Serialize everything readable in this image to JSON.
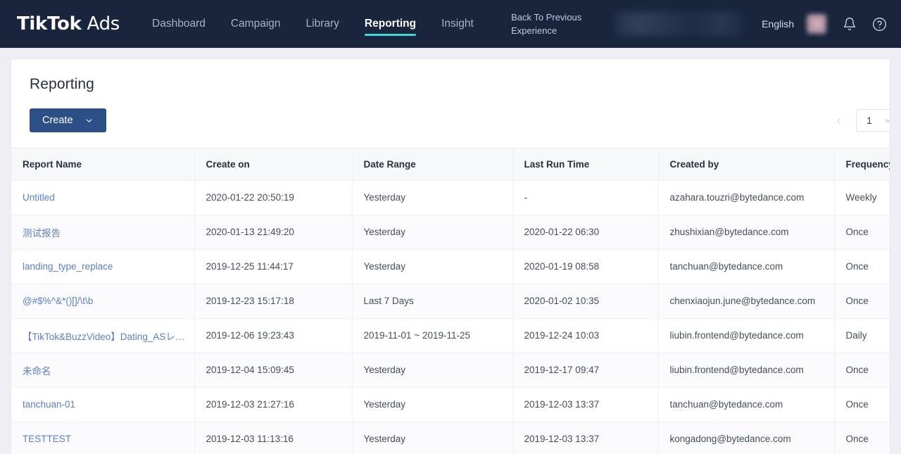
{
  "topnav": {
    "brand_bold": "TikTok",
    "brand_light": " Ads",
    "links": [
      {
        "label": "Dashboard",
        "active": false
      },
      {
        "label": "Campaign",
        "active": false
      },
      {
        "label": "Library",
        "active": false
      },
      {
        "label": "Reporting",
        "active": true
      },
      {
        "label": "Insight",
        "active": false
      }
    ],
    "back_link": "Back To Previous Experience",
    "language": "English",
    "account_selector": "",
    "icons": {
      "notification": "bell-icon",
      "help": "question-circle-icon",
      "avatar": "user-avatar"
    }
  },
  "page": {
    "title": "Reporting"
  },
  "toolbar": {
    "create_label": "Create",
    "pagination": {
      "prev_label": "‹",
      "current_page": "1"
    }
  },
  "table": {
    "columns": [
      "Report Name",
      "Create on",
      "Date Range",
      "Last Run Time",
      "Created by",
      "Frequency"
    ],
    "rows": [
      {
        "name": "Untitled",
        "create_on": "2020-01-22 20:50:19",
        "date_range": "Yesterday",
        "last_run": "-",
        "created_by": "azahara.touzri@bytedance.com",
        "frequency": "Weekly"
      },
      {
        "name": "测试报告",
        "create_on": "2020-01-13 21:49:20",
        "date_range": "Yesterday",
        "last_run": "2020-01-22 06:30",
        "created_by": "zhushixian@bytedance.com",
        "frequency": "Once"
      },
      {
        "name": "landing_type_replace",
        "create_on": "2019-12-25 11:44:17",
        "date_range": "Yesterday",
        "last_run": "2020-01-19 08:58",
        "created_by": "tanchuan@bytedance.com",
        "frequency": "Once"
      },
      {
        "name": "@#$%^&*()[]/\\t\\b",
        "create_on": "2019-12-23 15:17:18",
        "date_range": "Last 7 Days",
        "last_run": "2020-01-02 10:35",
        "created_by": "chenxiaojun.june@bytedance.com",
        "frequency": "Once"
      },
      {
        "name": "【TikTok&BuzzVideo】Dating_ASレポ…",
        "create_on": "2019-12-06 19:23:43",
        "date_range": "2019-11-01 ~ 2019-11-25",
        "last_run": "2019-12-24 10:03",
        "created_by": "liubin.frontend@bytedance.com",
        "frequency": "Daily"
      },
      {
        "name": "未命名",
        "create_on": "2019-12-04 15:09:45",
        "date_range": "Yesterday",
        "last_run": "2019-12-17 09:47",
        "created_by": "liubin.frontend@bytedance.com",
        "frequency": "Once"
      },
      {
        "name": "tanchuan-01",
        "create_on": "2019-12-03 21:27:16",
        "date_range": "Yesterday",
        "last_run": "2019-12-03 13:37",
        "created_by": "tanchuan@bytedance.com",
        "frequency": "Once"
      },
      {
        "name": "TESTTEST",
        "create_on": "2019-12-03 11:13:16",
        "date_range": "Yesterday",
        "last_run": "2019-12-03 13:37",
        "created_by": "kongadong@bytedance.com",
        "frequency": "Once"
      }
    ]
  },
  "colors": {
    "nav_background": "#18253d",
    "accent_teal": "#3fd6d6",
    "primary_button": "#2c4f87",
    "link_blue": "#5b7fc4",
    "page_background": "#eeeef3"
  }
}
